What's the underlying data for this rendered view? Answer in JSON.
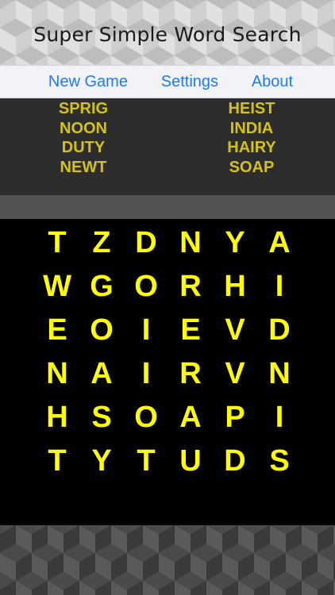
{
  "app": {
    "title": "Super Simple Word Search"
  },
  "menu": {
    "new_game": "New Game",
    "settings": "Settings",
    "about": "About"
  },
  "words": {
    "left": [
      "SPRIG",
      "NOON",
      "DUTY",
      "NEWT"
    ],
    "right": [
      "HEIST",
      "INDIA",
      "HAIRY",
      "SOAP"
    ]
  },
  "grid": [
    [
      "T",
      "Z",
      "D",
      "N",
      "Y",
      "A"
    ],
    [
      "W",
      "G",
      "O",
      "R",
      "H",
      "I"
    ],
    [
      "E",
      "O",
      "I",
      "E",
      "V",
      "D"
    ],
    [
      "N",
      "A",
      "I",
      "R",
      "V",
      "N"
    ],
    [
      "H",
      "S",
      "O",
      "A",
      "P",
      "I"
    ],
    [
      "T",
      "Y",
      "T",
      "U",
      "D",
      "S"
    ]
  ],
  "colors": {
    "word_list": "#d4c21a",
    "grid_letters": "#ffff00",
    "menu_links": "#1c7cf4",
    "board_background": "#000000"
  }
}
